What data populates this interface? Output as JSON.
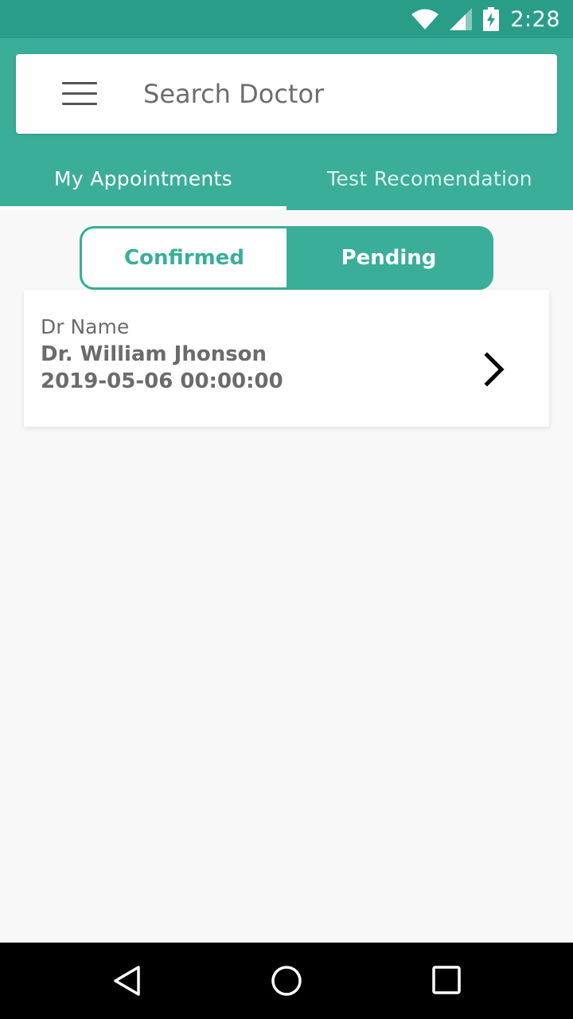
{
  "status_bar": {
    "time": "2:28",
    "icons": [
      "wifi-icon",
      "signal-icon",
      "battery-charging-icon"
    ]
  },
  "header": {
    "menu_icon": "hamburger-menu-icon",
    "search": {
      "placeholder": "Search Doctor",
      "value": ""
    }
  },
  "tabs": [
    {
      "label": "My Appointments",
      "active": true
    },
    {
      "label": "Test Recomendation",
      "active": false
    }
  ],
  "segmented": {
    "confirmed_label": "Confirmed",
    "pending_label": "Pending",
    "selected": "Pending"
  },
  "appointments": [
    {
      "label": "Dr Name",
      "doctor": "Dr. William Jhonson",
      "datetime": "2019-05-06 00:00:00",
      "icon": "chevron-right-icon"
    }
  ],
  "nav_bar": {
    "icons": [
      "back-icon",
      "home-icon",
      "recents-icon"
    ]
  },
  "colors": {
    "status_bar": "#2a9d89",
    "primary": "#3aae99",
    "background": "#f8f8f8",
    "text_secondary": "#6b6b6b"
  }
}
